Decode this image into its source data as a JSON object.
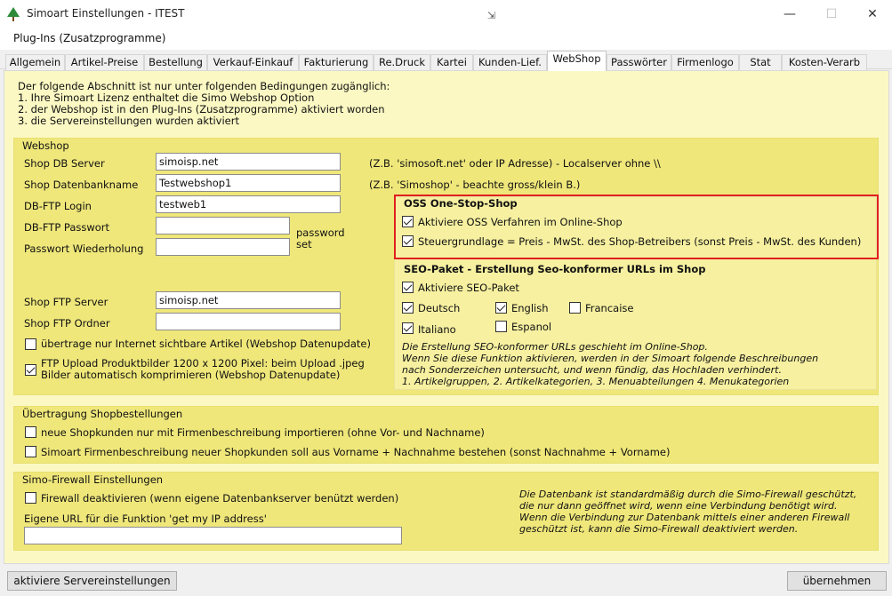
{
  "window": {
    "title": "Simoart Einstellungen - ITEST",
    "min": "—",
    "max": "☐",
    "close": "✕"
  },
  "menu": {
    "plugins": "Plug-Ins (Zusatzprogramme)"
  },
  "tabs": [
    "Allgemein",
    "Artikel-Preise",
    "Bestellung",
    "Verkauf-Einkauf",
    "Fakturierung",
    "Re.Druck",
    "Kartei",
    "Kunden-Lief.",
    "WebShop",
    "Passwörter",
    "Firmenlogo",
    "Stat",
    "Kosten-Verarb"
  ],
  "active_tab": "WebShop",
  "intro": {
    "line1": "Der folgende Abschnitt ist nur unter folgenden Bedingungen zugänglich:",
    "line2": "1. Ihre Simoart Lizenz enthaltet die Simo Webshop Option",
    "line3": "2. der Webshop ist in den Plug-Ins (Zusatzprogramme) aktiviert worden",
    "line4": "3. die Servereinstellungen wurden aktiviert"
  },
  "webshop": {
    "title": "Webshop",
    "db_server_label": "Shop DB Server",
    "db_server_value": "simoisp.net",
    "db_server_hint": "(Z.B. 'simosoft.net' oder IP Adresse) - Localserver ohne \\\\",
    "db_name_label": "Shop Datenbankname",
    "db_name_value": "Testwebshop1",
    "db_name_hint": "(Z.B. 'Simoshop' - beachte gross/klein B.)",
    "ftp_login_label": "DB-FTP Login",
    "ftp_login_value": "testweb1",
    "ftp_pass_label": "DB-FTP Passwort",
    "ftp_pass_value": "",
    "pass_repeat_label": "Passwort Wiederholung",
    "pass_repeat_value": "",
    "password_set_1": "password",
    "password_set_2": "set",
    "ftp_server_label": "Shop FTP Server",
    "ftp_server_value": "simoisp.net",
    "ftp_folder_label": "Shop FTP Ordner",
    "ftp_folder_value": "",
    "only_visible_label": "übertrage nur Internet sichtbare Artikel (Webshop Datenupdate)",
    "ftp_upload_label1": "FTP Upload Produktbilder 1200 x 1200 Pixel:  beim Upload .jpeg",
    "ftp_upload_label2": "Bilder automatisch komprimieren (Webshop Datenupdate)"
  },
  "oss": {
    "title": "OSS One-Stop-Shop",
    "activate_label": "Aktiviere OSS Verfahren im Online-Shop",
    "tax_label": "Steuergrundlage = Preis - MwSt. des Shop-Betreibers (sonst Preis - MwSt. des Kunden)"
  },
  "seo": {
    "title": "SEO-Paket  - Erstellung Seo-konformer URLs im Shop",
    "activate_label": "Aktiviere SEO-Paket",
    "deutsch": "Deutsch",
    "english": "English",
    "francaise": "Francaise",
    "espanol": "Espanol",
    "italiano": "Italiano",
    "info1": "Die Erstellung SEO-konformer URLs geschieht im Online-Shop.",
    "info2": "Wenn Sie diese Funktion aktivieren, werden in der Simoart folgende Beschreibungen",
    "info3": "nach Sonderzeichen untersucht, und wenn fündig, das Hochladen verhindert.",
    "info4": "1. Artikelgruppen, 2. Artikelkategorien, 3. Menuabteilungen 4. Menukategorien"
  },
  "transfer": {
    "title": "Übertragung Shopbestellungen",
    "opt1": "neue Shopkunden nur mit Firmenbeschreibung importieren (ohne Vor- und Nachname)",
    "opt2": "Simoart Firmenbeschreibung neuer Shopkunden soll aus Vorname + Nachnahme bestehen (sonst Nachnahme + Vorname)"
  },
  "firewall": {
    "title": "Simo-Firewall Einstellungen",
    "disable_label": "Firewall deaktivieren (wenn eigene Datenbankserver benützt werden)",
    "url_label": "Eigene URL für die Funktion 'get my IP address'",
    "url_value": "",
    "info1": "Die Datenbank ist standardmäßig durch die Simo-Firewall geschützt,",
    "info2": "die nur dann geöffnet wird, wenn eine Verbindung benötigt wird.",
    "info3": "Wenn die Verbindung zur Datenbank mittels einer anderen Firewall",
    "info4": "geschützt ist, kann die Simo-Firewall deaktiviert werden."
  },
  "buttons": {
    "activate_server": "aktiviere Servereinstellungen",
    "apply": "übernehmen"
  }
}
